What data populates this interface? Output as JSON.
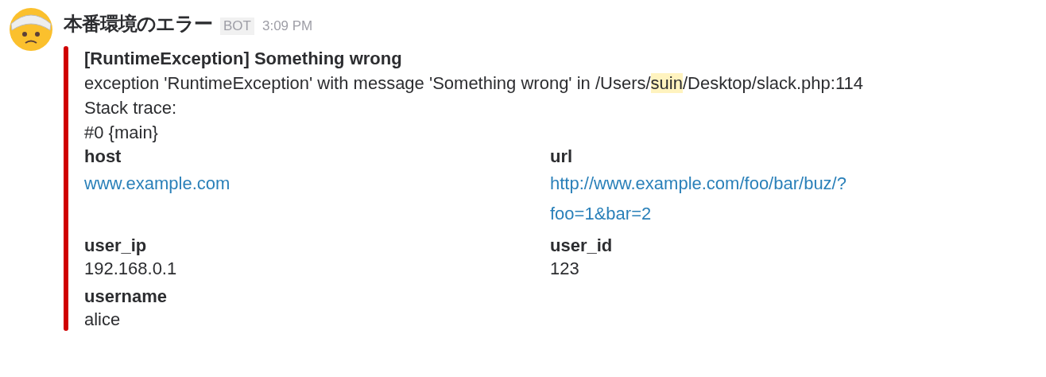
{
  "sender": {
    "name": "本番環境のエラー",
    "badge": "BOT",
    "time": "3:09 PM"
  },
  "attachment": {
    "color": "#d00000",
    "title": "[RuntimeException] Something wrong",
    "message": [
      {
        "text": "exception 'RuntimeException' with message 'Something wrong' in /Users/",
        "highlighted": false
      },
      {
        "text": "suin",
        "highlighted": true
      },
      {
        "text": "/Desktop/slack.php:114",
        "highlighted": false
      }
    ],
    "lines": [
      "Stack trace:",
      "#0 {main}"
    ],
    "fields": [
      {
        "title": "host",
        "value": "www.example.com",
        "kind": "link"
      },
      {
        "title": "url",
        "value": "http://www.example.com/foo/bar/buz/?foo=1&bar=2",
        "kind": "link"
      },
      {
        "title": "user_ip",
        "value": "192.168.0.1",
        "kind": "text"
      },
      {
        "title": "user_id",
        "value": "123",
        "kind": "text"
      },
      {
        "title": "username",
        "value": "alice",
        "kind": "text"
      }
    ]
  }
}
